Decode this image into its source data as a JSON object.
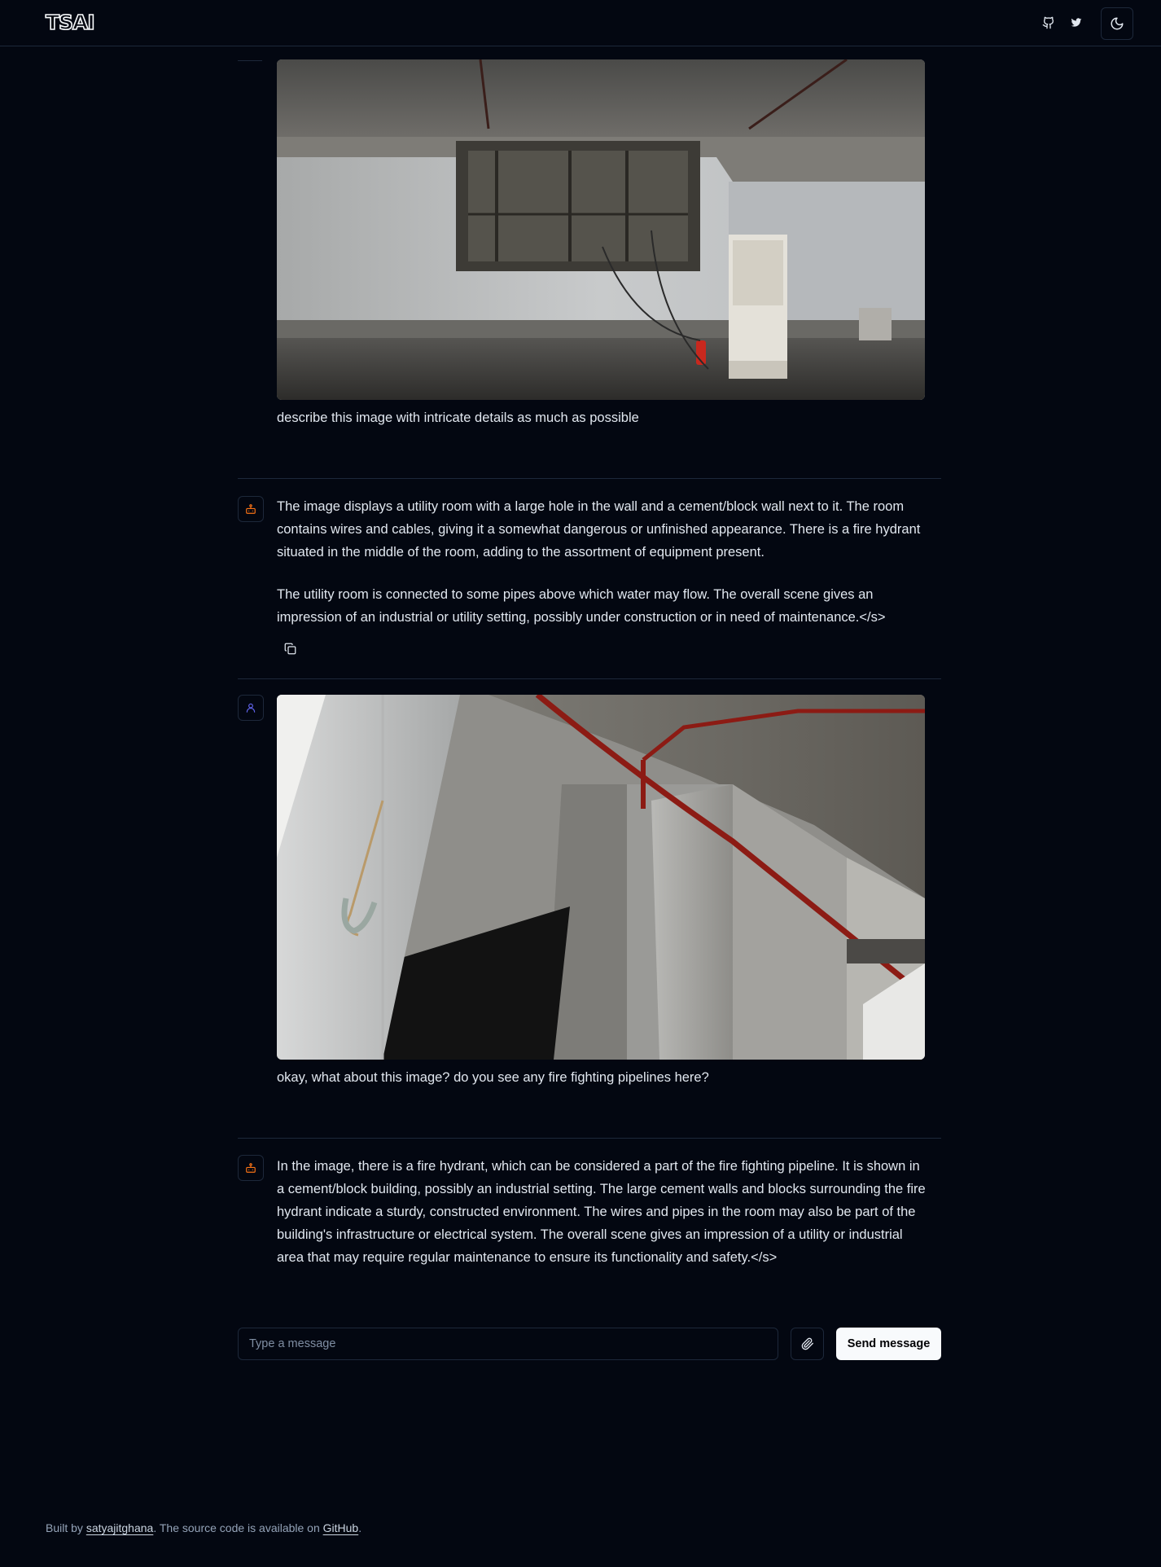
{
  "header": {
    "logo": "TSAI",
    "icons": [
      "github-icon",
      "twitter-icon",
      "moon-icon"
    ]
  },
  "messages": [
    {
      "role": "user",
      "image_desc": "utility-room-photo",
      "text": "describe this image with intricate details as much as possible"
    },
    {
      "role": "assistant",
      "paragraphs": [
        "The image displays a utility room with a large hole in the wall and a cement/block wall next to it. The room contains wires and cables, giving it a somewhat dangerous or unfinished appearance. There is a fire hydrant situated in the middle of the room, adding to the assortment of equipment present.",
        "The utility room is connected to some pipes above which water may flow. The overall scene gives an impression of an industrial or utility setting, possibly under construction or in need of maintenance.</s>"
      ]
    },
    {
      "role": "user",
      "image_desc": "concrete-corner-pipe-photo",
      "text": "okay, what about this image? do you see any fire fighting pipelines here?"
    },
    {
      "role": "assistant",
      "paragraphs": [
        "In the image, there is a fire hydrant, which can be considered a part of the fire fighting pipeline. It is shown in a cement/block building, possibly an industrial setting. The large cement walls and blocks surrounding the fire hydrant indicate a sturdy, constructed environment. The wires and pipes in the room may also be part of the building's infrastructure or electrical system. The overall scene gives an impression of a utility or industrial area that may require regular maintenance to ensure its functionality and safety.</s>"
      ]
    }
  ],
  "composer": {
    "placeholder": "Type a message",
    "send_label": "Send message"
  },
  "footer": {
    "prefix": "Built by ",
    "author": "satyajitghana",
    "middle": ". The source code is available on ",
    "link": "GitHub",
    "suffix": "."
  },
  "colors": {
    "background": "#030711",
    "border": "#1d283a",
    "text": "#e1e7ef",
    "assistant_icon": "#f97316",
    "user_icon": "#6366f1",
    "button_bg": "#f8fafc"
  }
}
